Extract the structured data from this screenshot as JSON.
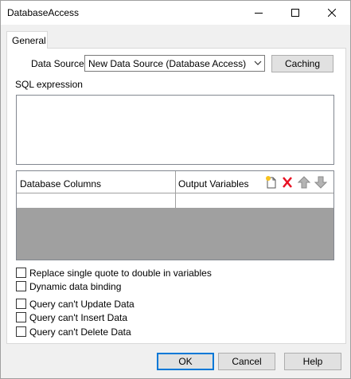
{
  "window": {
    "title": "DatabaseAccess"
  },
  "tabs": [
    {
      "label": "General"
    }
  ],
  "data_source": {
    "label": "Data Source:",
    "selected": "New Data Source (Database Access)",
    "caching_label": "Caching"
  },
  "sql": {
    "label": "SQL expression",
    "value": ""
  },
  "grid": {
    "columns": [
      "Database Columns",
      "Output Variables"
    ],
    "toolbar_icons": [
      "add-row-icon",
      "delete-icon",
      "move-up-icon",
      "move-down-icon"
    ]
  },
  "options": [
    {
      "label": "Replace single quote to double in variables",
      "checked": false
    },
    {
      "label": "Dynamic data binding",
      "checked": false
    },
    {
      "label": "Query can't Update Data",
      "checked": false
    },
    {
      "label": "Query can't Insert Data",
      "checked": false
    },
    {
      "label": "Query can't Delete Data",
      "checked": false
    }
  ],
  "buttons": {
    "ok": "OK",
    "cancel": "Cancel",
    "help": "Help"
  },
  "colors": {
    "accent": "#0078d7",
    "delete": "#e81123",
    "grid_empty": "#a0a0a0"
  }
}
